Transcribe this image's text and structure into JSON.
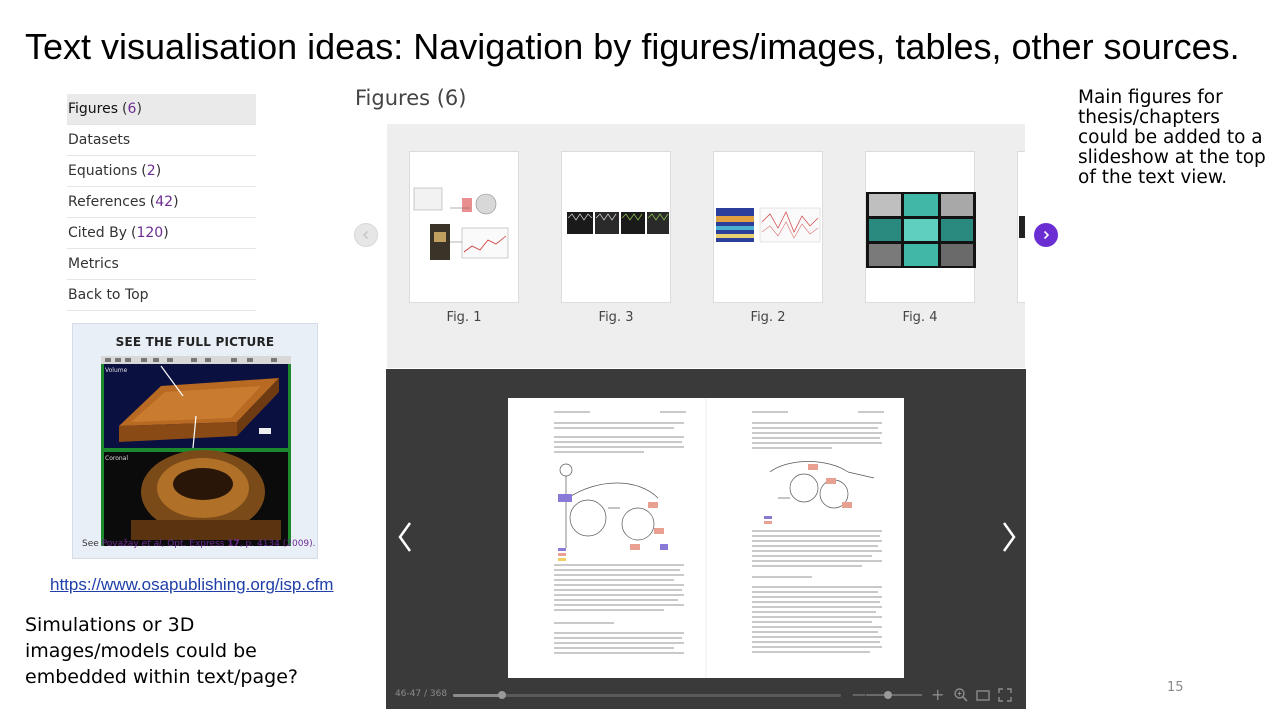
{
  "slide": {
    "title": "Text visualisation ideas: Navigation by figures/images, tables, other sources.",
    "number": "15"
  },
  "sidebar": {
    "items": [
      {
        "label": "Figures",
        "count": "6",
        "active": true
      },
      {
        "label": "Datasets",
        "count": null,
        "active": false
      },
      {
        "label": "Equations",
        "count": "2",
        "active": false
      },
      {
        "label": "References",
        "count": "42",
        "active": false
      },
      {
        "label": "Cited By",
        "count": "120",
        "active": false
      },
      {
        "label": "Metrics",
        "count": null,
        "active": false
      },
      {
        "label": "Back to Top",
        "count": null,
        "active": false
      }
    ]
  },
  "full_picture": {
    "title": "SEE THE FULL PICTURE",
    "caption_prefix": "See ",
    "caption_authors": "Považay",
    "caption_etal": " et al",
    "caption_journal": ", Opt. Express ",
    "caption_volume": "17",
    "caption_rest": ", p. 4134 (2009)."
  },
  "link": {
    "url_text": "https://www.osapublishing.org/isp.cfm"
  },
  "notes": {
    "left": "Simulations or 3D images/models could be embedded within text/page?",
    "right": "Main figures for thesis/chapters could be added to a slideshow at the top of the text view."
  },
  "figures": {
    "heading": "Figures (6)",
    "cards": [
      {
        "label": "Fig. 1"
      },
      {
        "label": "Fig. 3"
      },
      {
        "label": "Fig. 2"
      },
      {
        "label": "Fig. 4"
      }
    ]
  },
  "viewer": {
    "page_counter": "46-47 / 368",
    "progress_fraction": 0.125,
    "zoom_fraction": 0.4,
    "zoom_minus": "—",
    "zoom_plus": "+"
  },
  "colors": {
    "accent_purple": "#6a2ed2",
    "count_purple": "#6b2c91",
    "link_blue": "#1f3fa8",
    "viewer_bg": "#3a3a3a"
  }
}
